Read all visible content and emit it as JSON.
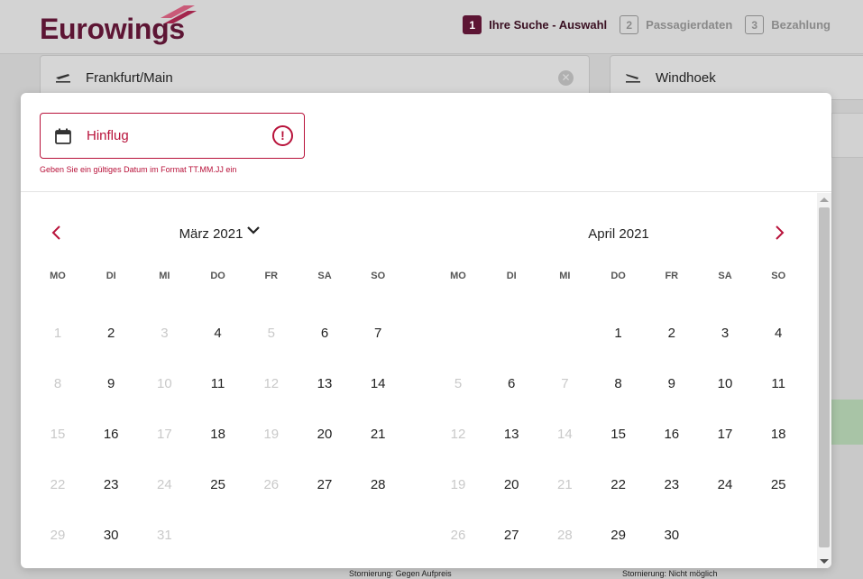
{
  "header": {
    "logo": "Eurowings",
    "steps": [
      {
        "num": "1",
        "label": "Ihre Suche - Auswahl",
        "active": true
      },
      {
        "num": "2",
        "label": "Passagierdaten",
        "active": false
      },
      {
        "num": "3",
        "label": "Bezahlung",
        "active": false
      }
    ]
  },
  "search": {
    "origin": "Frankfurt/Main",
    "destination": "Windhoek"
  },
  "background_notes": {
    "left": "Stornierung: Gegen Aufpreis",
    "right": "Stornierung: Nicht möglich"
  },
  "datepicker": {
    "field_label": "Hinflug",
    "error_message": "Geben Sie ein gültiges Datum im Format TT.MM.JJ ein",
    "weekdays": [
      "MO",
      "DI",
      "MI",
      "DO",
      "FR",
      "SA",
      "SO"
    ],
    "months": [
      {
        "title": "März 2021",
        "weeks": [
          [
            {
              "d": "1",
              "off": true
            },
            {
              "d": "2",
              "off": false
            },
            {
              "d": "3",
              "off": true
            },
            {
              "d": "4",
              "off": false
            },
            {
              "d": "5",
              "off": true
            },
            {
              "d": "6",
              "off": false
            },
            {
              "d": "7",
              "off": false
            }
          ],
          [
            {
              "d": "8",
              "off": true
            },
            {
              "d": "9",
              "off": false
            },
            {
              "d": "10",
              "off": true
            },
            {
              "d": "11",
              "off": false
            },
            {
              "d": "12",
              "off": true
            },
            {
              "d": "13",
              "off": false
            },
            {
              "d": "14",
              "off": false
            }
          ],
          [
            {
              "d": "15",
              "off": true
            },
            {
              "d": "16",
              "off": false
            },
            {
              "d": "17",
              "off": true
            },
            {
              "d": "18",
              "off": false
            },
            {
              "d": "19",
              "off": true
            },
            {
              "d": "20",
              "off": false
            },
            {
              "d": "21",
              "off": false
            }
          ],
          [
            {
              "d": "22",
              "off": true
            },
            {
              "d": "23",
              "off": false
            },
            {
              "d": "24",
              "off": true
            },
            {
              "d": "25",
              "off": false
            },
            {
              "d": "26",
              "off": true
            },
            {
              "d": "27",
              "off": false
            },
            {
              "d": "28",
              "off": false
            }
          ],
          [
            {
              "d": "29",
              "off": true
            },
            {
              "d": "30",
              "off": false
            },
            {
              "d": "31",
              "off": true
            },
            null,
            null,
            null,
            null
          ]
        ]
      },
      {
        "title": "April 2021",
        "weeks": [
          [
            null,
            null,
            null,
            {
              "d": "1",
              "off": false
            },
            {
              "d": "2",
              "off": false
            },
            {
              "d": "3",
              "off": false
            },
            {
              "d": "4",
              "off": false
            }
          ],
          [
            {
              "d": "5",
              "off": true
            },
            {
              "d": "6",
              "off": false
            },
            {
              "d": "7",
              "off": true
            },
            {
              "d": "8",
              "off": false
            },
            {
              "d": "9",
              "off": false
            },
            {
              "d": "10",
              "off": false
            },
            {
              "d": "11",
              "off": false
            }
          ],
          [
            {
              "d": "12",
              "off": true
            },
            {
              "d": "13",
              "off": false
            },
            {
              "d": "14",
              "off": true
            },
            {
              "d": "15",
              "off": false
            },
            {
              "d": "16",
              "off": false
            },
            {
              "d": "17",
              "off": false
            },
            {
              "d": "18",
              "off": false
            }
          ],
          [
            {
              "d": "19",
              "off": true
            },
            {
              "d": "20",
              "off": false
            },
            {
              "d": "21",
              "off": true
            },
            {
              "d": "22",
              "off": false
            },
            {
              "d": "23",
              "off": false
            },
            {
              "d": "24",
              "off": false
            },
            {
              "d": "25",
              "off": false
            }
          ],
          [
            {
              "d": "26",
              "off": true
            },
            {
              "d": "27",
              "off": false
            },
            {
              "d": "28",
              "off": true
            },
            {
              "d": "29",
              "off": false
            },
            {
              "d": "30",
              "off": false
            },
            null,
            null
          ]
        ]
      }
    ]
  },
  "colors": {
    "brand": "#5d1534",
    "error": "#b8123a",
    "disabled_day": "#c9c9c9"
  }
}
